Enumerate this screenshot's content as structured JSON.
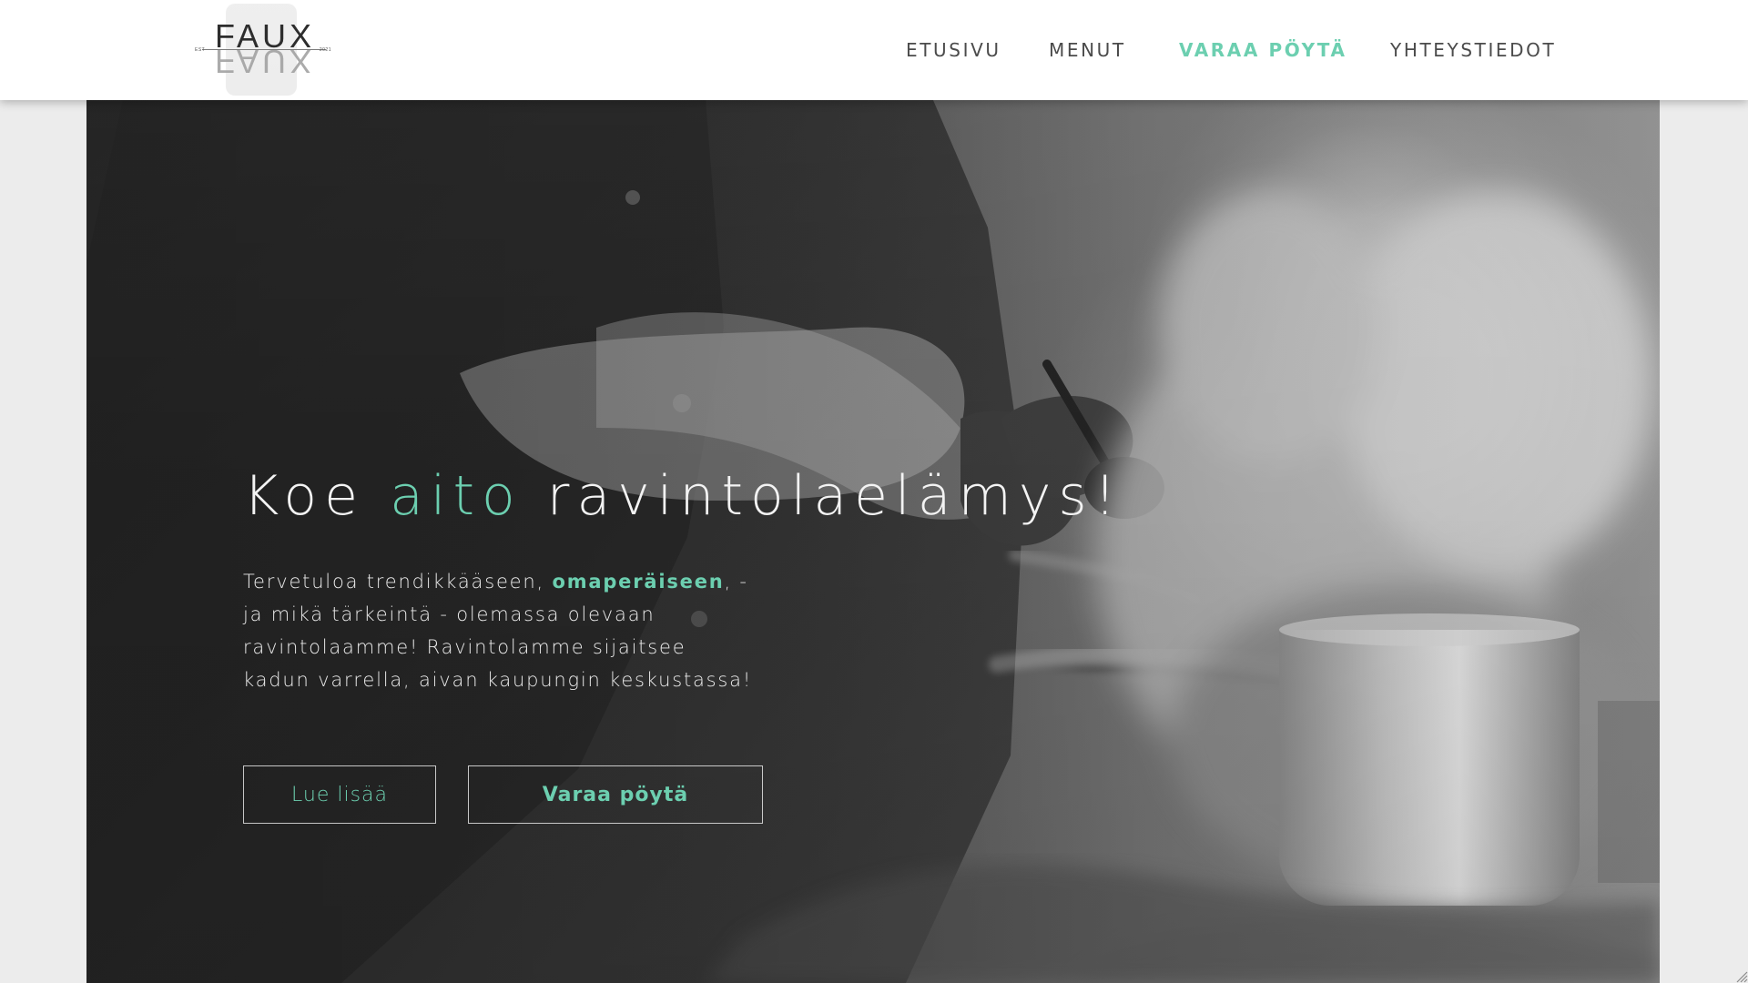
{
  "header": {
    "logo": {
      "text": "FAUX",
      "left_small": "EST",
      "right_small": "2021"
    },
    "nav": [
      {
        "label": "ETUSIVU",
        "state": "default"
      },
      {
        "label": "MENUT",
        "state": "default"
      },
      {
        "label": "VARAA PÖYTÄ",
        "state": "active"
      },
      {
        "label": "YHTEYSTIEDOT",
        "state": "default"
      }
    ]
  },
  "hero": {
    "title_prefix": "Koe ",
    "title_accent": "aito",
    "title_suffix": " ravintolaelämys!",
    "intro_prefix": "Tervetuloa trendikkääseen, ",
    "intro_accent": "omaperäiseen",
    "intro_suffix": ", - ja mikä tärkeintä - olemassa olevaan ravintolaamme! Ravintolamme sijaitsee kadun varrella, aivan kaupungin keskustassa!",
    "buttons": {
      "read_more": "Lue lisää",
      "book_table": "Varaa pöytä"
    }
  },
  "colors": {
    "accent": "#6ccfb0",
    "header_bg": "#ffffff",
    "page_bg": "#ececec",
    "text_dark": "#4b4b4b",
    "text_light": "#f3f3f3"
  },
  "icons": {
    "resize_handle": "resize-handle-icon"
  }
}
